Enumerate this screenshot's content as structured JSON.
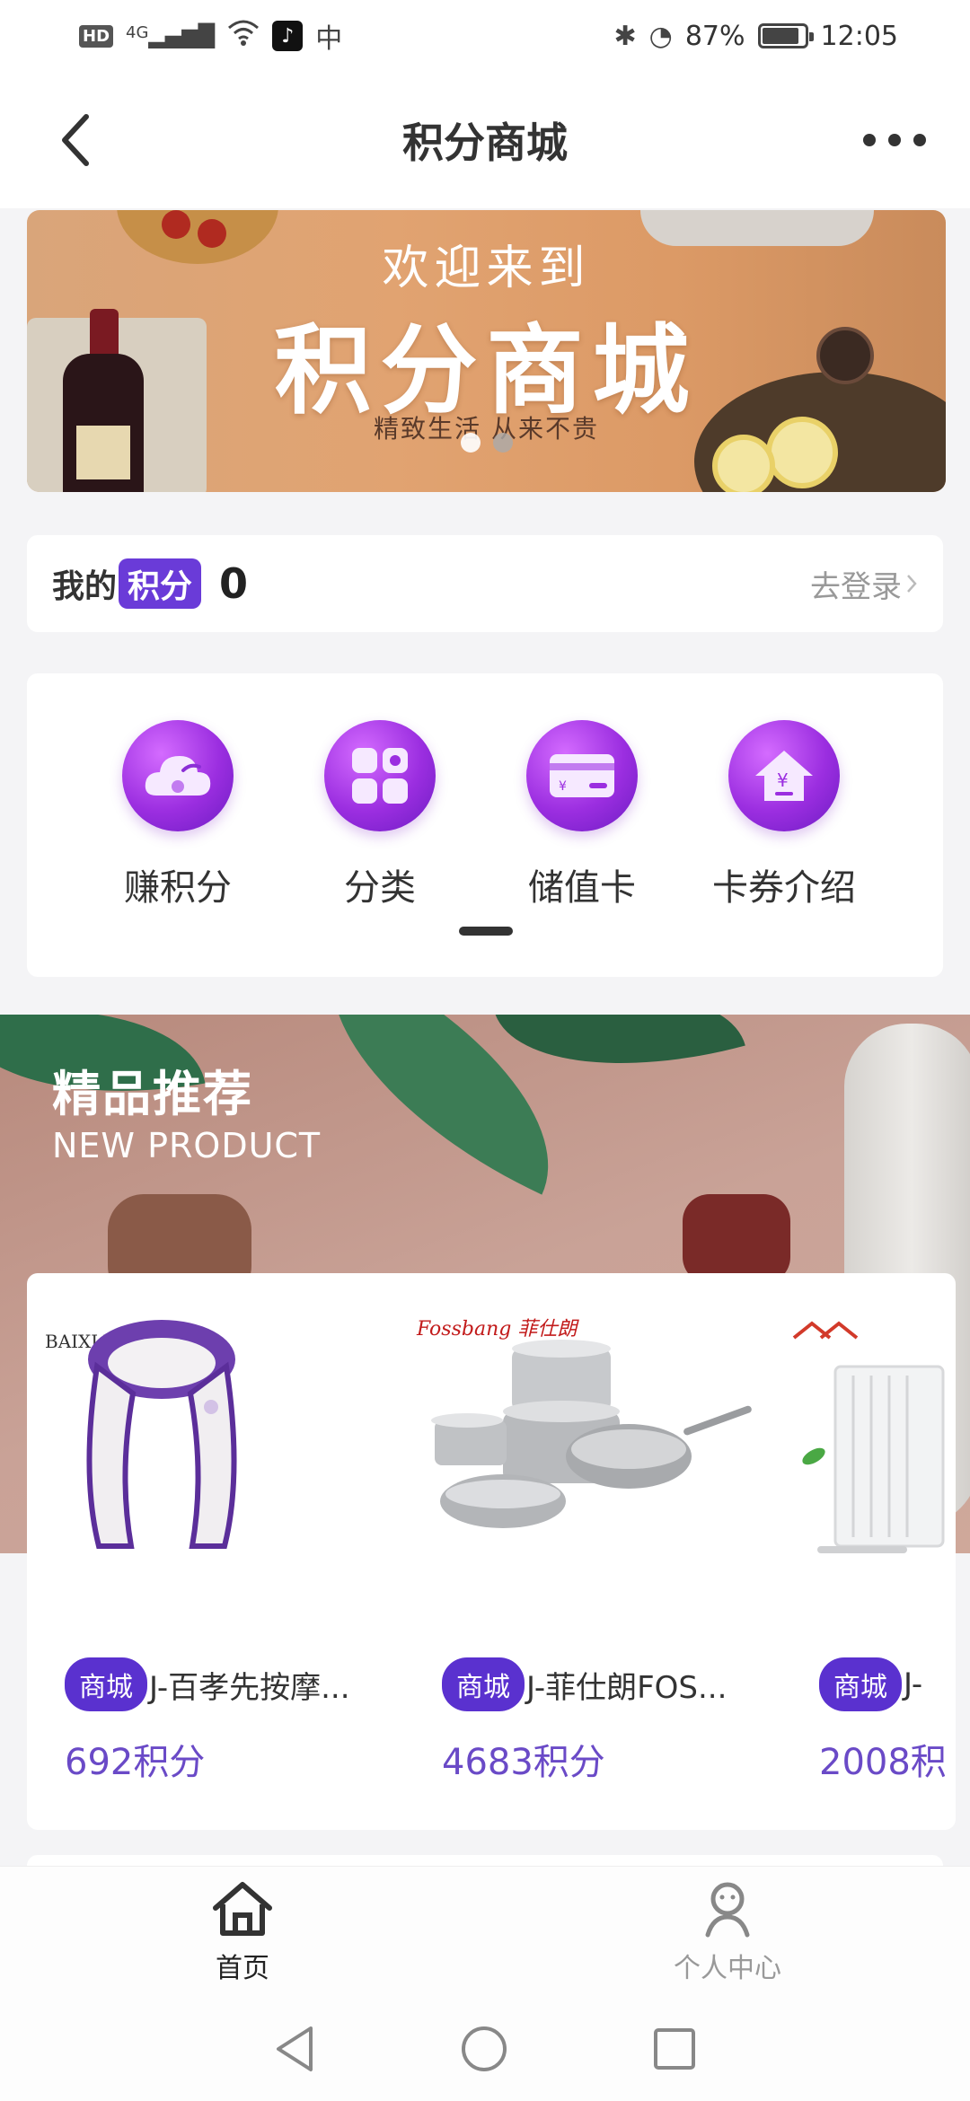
{
  "status_bar": {
    "network": "4G",
    "hd_badge": "HD",
    "battery": "87%",
    "battery_level": 0.87,
    "time": "12:05",
    "app_glyph": "中"
  },
  "header": {
    "title": "积分商城",
    "back_icon": "chevron-left-icon",
    "more_icon": "more-dots-icon"
  },
  "banner": {
    "subtitle": "欢迎来到",
    "title": "积分商城",
    "slogan": "精致生活 从来不贵",
    "slides": 2,
    "active_slide": 0
  },
  "points": {
    "label_prefix": "我的",
    "label_highlight": "积分",
    "value": "0",
    "login_text": "去登录",
    "accent": "#6a3bd8"
  },
  "quick_actions": [
    {
      "label": "赚积分",
      "icon": "cloud-icon"
    },
    {
      "label": "分类",
      "icon": "grid-icon"
    },
    {
      "label": "储值卡",
      "icon": "card-icon"
    },
    {
      "label": "卡券介绍",
      "icon": "yen-house-icon"
    }
  ],
  "featured": {
    "title": "精品推荐",
    "subtitle": "NEW PRODUCT",
    "products": [
      {
        "brand": "BAIXIAOXIAN",
        "tag": "商城",
        "name": "J-百孝先按摩...",
        "price": "692积分"
      },
      {
        "brand": "Fossbang 菲仕朗",
        "tag": "商城",
        "name": "J-菲仕朗FOS...",
        "price": "4683积分"
      },
      {
        "brand": "",
        "tag": "商城",
        "name": "J-",
        "price": "2008积"
      }
    ]
  },
  "tabs": [
    {
      "label": "首页",
      "icon": "home-icon",
      "active": true
    },
    {
      "label": "个人中心",
      "icon": "user-icon",
      "active": false
    }
  ],
  "colors": {
    "accent": "#6a3bd8",
    "price": "#6a4ac7",
    "tag": "#5a31cf"
  }
}
